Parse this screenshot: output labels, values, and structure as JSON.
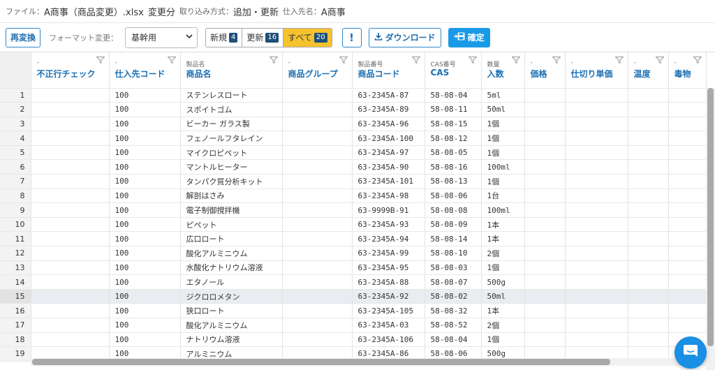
{
  "info": {
    "file_label": "ファイル：",
    "file_name": "A商事（商品変更）.xlsx",
    "diff_label": "変更分",
    "import_label": "取り込み方式：",
    "import_value": "追加・更新",
    "vendor_label": "仕入先名：",
    "vendor_value": "A商事"
  },
  "toolbar": {
    "reconvert_label": "再変換",
    "format_label": "フォーマット変更：",
    "format_value": "基幹用",
    "filters": [
      {
        "label": "新規",
        "count": "4",
        "active": false
      },
      {
        "label": "更新",
        "count": "16",
        "active": false
      },
      {
        "label": "すべて",
        "count": "20",
        "active": true
      }
    ],
    "alert_label": "!",
    "download_label": "ダウンロード",
    "confirm_label": "確定"
  },
  "columns": [
    {
      "sub": "-",
      "label": "不正行チェック"
    },
    {
      "sub": "-",
      "label": "仕入先コード"
    },
    {
      "sub": "製品名",
      "label": "商品名"
    },
    {
      "sub": "-",
      "label": "商品グループ"
    },
    {
      "sub": "製品番号",
      "label": "商品コード"
    },
    {
      "sub": "CAS番号",
      "label": "CAS"
    },
    {
      "sub": "数量",
      "label": "入数"
    },
    {
      "sub": "-",
      "label": "価格"
    },
    {
      "sub": "-",
      "label": "仕切り単価"
    },
    {
      "sub": "-",
      "label": "温度"
    },
    {
      "sub": "-",
      "label": "毒物"
    }
  ],
  "rows": [
    {
      "n": "1",
      "check": "",
      "vendor": "100",
      "name": "ステンレスロート",
      "group": "",
      "code": "63-2345A-87",
      "cas": "58-08-04",
      "qty": "5ml"
    },
    {
      "n": "2",
      "check": "",
      "vendor": "100",
      "name": "スポイトゴム",
      "group": "",
      "code": "63-2345A-89",
      "cas": "58-08-11",
      "qty": "50ml"
    },
    {
      "n": "3",
      "check": "",
      "vendor": "100",
      "name": "ビーカー ガラス製",
      "group": "",
      "code": "63-2345A-96",
      "cas": "58-08-15",
      "qty": "1個"
    },
    {
      "n": "4",
      "check": "",
      "vendor": "100",
      "name": "フェノールフタレイン",
      "group": "",
      "code": "63-2345A-100",
      "cas": "58-08-12",
      "qty": "1個"
    },
    {
      "n": "5",
      "check": "",
      "vendor": "100",
      "name": "マイクロピペット",
      "group": "",
      "code": "63-2345A-97",
      "cas": "58-08-05",
      "qty": "1個"
    },
    {
      "n": "6",
      "check": "",
      "vendor": "100",
      "name": "マントルヒーター",
      "group": "",
      "code": "63-2345A-90",
      "cas": "58-08-16",
      "qty": "100ml"
    },
    {
      "n": "7",
      "check": "",
      "vendor": "100",
      "name": "タンパク質分析キット",
      "group": "",
      "code": "63-2345A-101",
      "cas": "58-08-13",
      "qty": "1個"
    },
    {
      "n": "8",
      "check": "",
      "vendor": "100",
      "name": "解剖はさみ",
      "group": "",
      "code": "63-2345A-98",
      "cas": "58-08-06",
      "qty": "1台"
    },
    {
      "n": "9",
      "check": "",
      "vendor": "100",
      "name": "電子制御撹拌機",
      "group": "",
      "code": "63-9999B-91",
      "cas": "58-08-08",
      "qty": "100ml"
    },
    {
      "n": "10",
      "check": "",
      "vendor": "100",
      "name": "ピペット",
      "group": "",
      "code": "63-2345A-93",
      "cas": "58-08-09",
      "qty": "1本"
    },
    {
      "n": "11",
      "check": "",
      "vendor": "100",
      "name": "広口ロート",
      "group": "",
      "code": "63-2345A-94",
      "cas": "58-08-14",
      "qty": "1本"
    },
    {
      "n": "12",
      "check": "",
      "vendor": "100",
      "name": "酸化アルミニウム",
      "group": "",
      "code": "63-2345A-99",
      "cas": "58-08-10",
      "qty": "2個"
    },
    {
      "n": "13",
      "check": "",
      "vendor": "100",
      "name": "水酸化ナトリウム溶液",
      "group": "",
      "code": "63-2345A-95",
      "cas": "58-08-03",
      "qty": "1個"
    },
    {
      "n": "14",
      "check": "",
      "vendor": "100",
      "name": "エタノール",
      "group": "",
      "code": "63-2345A-88",
      "cas": "58-08-07",
      "qty": "500g"
    },
    {
      "n": "15",
      "check": "",
      "vendor": "100",
      "name": "ジクロロメタン",
      "group": "",
      "code": "63-2345A-92",
      "cas": "58-08-02",
      "qty": "50ml"
    },
    {
      "n": "16",
      "check": "",
      "vendor": "100",
      "name": "狭口ロート",
      "group": "",
      "code": "63-2345A-105",
      "cas": "58-08-32",
      "qty": "1本"
    },
    {
      "n": "17",
      "check": "",
      "vendor": "100",
      "name": "酸化アルミニウム",
      "group": "",
      "code": "63-2345A-03",
      "cas": "58-08-52",
      "qty": "2個"
    },
    {
      "n": "18",
      "check": "",
      "vendor": "100",
      "name": "ナトリウム溶液",
      "group": "",
      "code": "63-2345A-106",
      "cas": "58-08-04",
      "qty": "1個"
    },
    {
      "n": "19",
      "check": "",
      "vendor": "100",
      "name": "アルミニウム",
      "group": "",
      "code": "63-2345A-86",
      "cas": "58-08-06",
      "qty": "500g"
    }
  ],
  "highlighted_row": "15",
  "colors": {
    "accent": "#1a9ae6",
    "active_filter": "#f6c22e",
    "header_text": "#1a6fb5",
    "highlight_row": "#e9ecf0"
  },
  "icons": [
    "filter-icon",
    "download-icon",
    "save-icon",
    "chat-icon",
    "chevron-down-icon"
  ]
}
